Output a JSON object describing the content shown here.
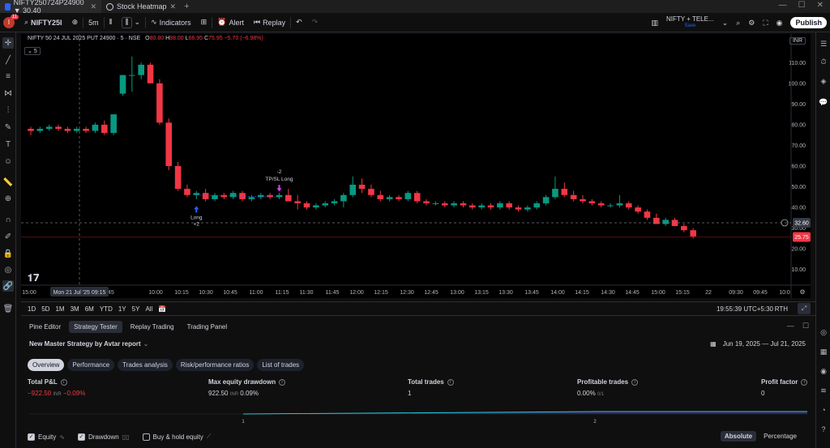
{
  "browser": {
    "tabs": [
      {
        "label": "NIFTY250724P24900 ▼ 30.40",
        "active": true
      },
      {
        "label": "Stock Heatmap",
        "active": false
      }
    ]
  },
  "toolbar": {
    "notif_count": "11",
    "symbol": "NIFTY25I",
    "interval": "5m",
    "indicators": "Indicators",
    "alert": "Alert",
    "replay": "Replay",
    "layout_name": "NIFTY + TELE...",
    "layout_sub": "Save",
    "publish": "Publish"
  },
  "legend": {
    "title": "NIFTY 50 24 JUL 2025 PUT 24900 · 5 · NSE",
    "o": "O",
    "o_val": "80.80",
    "h": "H",
    "h_val": "88.00",
    "l": "L",
    "l_val": "66.95",
    "c": "C",
    "c_val": "75.95",
    "chg": "−5.70 (−6.98%)",
    "sub": "5",
    "currency": "INR"
  },
  "chart_data": {
    "type": "candlestick",
    "y_ticks": [
      "110.00",
      "100.00",
      "90.00",
      "80.00",
      "70.00",
      "60.00",
      "50.00",
      "40.00",
      "30.00",
      "20.00",
      "10.00"
    ],
    "ylim": [
      4,
      116
    ],
    "x_ticks": [
      "15:00",
      "09:45",
      "10:00",
      "10:15",
      "10:30",
      "10:45",
      "11:00",
      "11:15",
      "11:30",
      "11:45",
      "12:00",
      "12:15",
      "12:30",
      "12:45",
      "13:00",
      "13:15",
      "13:30",
      "13:45",
      "14:00",
      "14:15",
      "14:30",
      "14:45",
      "15:00",
      "15:15",
      "22",
      "09:30",
      "09:45",
      "10:0"
    ],
    "crosshair_label": "Mon 21 Jul '25   09:15",
    "price_label_cross": "32.60",
    "price_label_last": "25.75",
    "candles": [
      [
        78,
        79,
        75,
        77
      ],
      [
        77,
        79,
        76,
        78
      ],
      [
        78,
        80,
        77,
        79
      ],
      [
        79,
        80,
        77,
        78
      ],
      [
        78,
        79,
        76,
        77
      ],
      [
        77,
        79,
        76,
        78
      ],
      [
        78,
        79,
        76,
        77
      ],
      [
        77,
        81,
        76,
        80
      ],
      [
        80,
        82,
        75,
        76
      ],
      [
        76,
        85,
        75,
        85
      ],
      [
        95,
        104,
        94,
        104
      ],
      [
        104,
        113,
        96,
        104
      ],
      [
        104,
        110,
        102,
        109
      ],
      [
        109,
        110,
        100,
        100
      ],
      [
        100,
        102,
        80,
        81
      ],
      [
        81,
        83,
        58,
        60
      ],
      [
        60,
        62,
        48,
        49
      ],
      [
        49,
        51,
        45,
        46
      ],
      [
        46,
        48,
        44,
        47
      ],
      [
        47,
        49,
        43,
        44
      ],
      [
        44,
        47,
        43,
        46
      ],
      [
        46,
        47,
        44,
        45
      ],
      [
        45,
        48,
        44,
        47
      ],
      [
        47,
        48,
        43,
        44
      ],
      [
        44,
        46,
        43,
        45
      ],
      [
        45,
        47,
        44,
        46
      ],
      [
        46,
        47,
        44,
        45
      ],
      [
        45,
        47,
        44,
        46
      ],
      [
        46,
        49,
        43,
        43
      ],
      [
        43,
        46,
        39,
        42
      ],
      [
        42,
        43,
        39,
        40
      ],
      [
        40,
        42,
        39,
        41
      ],
      [
        41,
        43,
        40,
        42
      ],
      [
        42,
        44,
        41,
        43
      ],
      [
        43,
        47,
        40,
        46
      ],
      [
        46,
        55,
        45,
        51
      ],
      [
        51,
        54,
        47,
        49
      ],
      [
        49,
        51,
        45,
        46
      ],
      [
        46,
        48,
        43,
        44
      ],
      [
        44,
        46,
        43,
        45
      ],
      [
        45,
        46,
        43,
        44
      ],
      [
        44,
        48,
        43,
        47
      ],
      [
        47,
        48,
        42,
        43
      ],
      [
        43,
        44,
        41,
        42
      ],
      [
        42,
        43,
        41,
        42
      ],
      [
        42,
        43,
        40,
        41
      ],
      [
        41,
        43,
        40,
        42
      ],
      [
        42,
        43,
        40,
        41
      ],
      [
        41,
        42,
        39,
        40
      ],
      [
        40,
        42,
        39,
        41
      ],
      [
        41,
        42,
        39,
        40
      ],
      [
        40,
        43,
        39,
        42
      ],
      [
        42,
        43,
        39,
        40
      ],
      [
        40,
        41,
        38,
        39
      ],
      [
        39,
        41,
        38,
        40
      ],
      [
        40,
        43,
        39,
        42
      ],
      [
        42,
        46,
        41,
        45
      ],
      [
        45,
        55,
        44,
        49
      ],
      [
        49,
        52,
        45,
        46
      ],
      [
        46,
        48,
        43,
        44
      ],
      [
        44,
        46,
        42,
        43
      ],
      [
        43,
        44,
        41,
        42
      ],
      [
        42,
        43,
        40,
        41
      ],
      [
        41,
        42,
        40,
        41
      ],
      [
        41,
        46,
        40,
        42
      ],
      [
        42,
        43,
        39,
        40
      ],
      [
        40,
        41,
        37,
        38
      ],
      [
        38,
        39,
        34,
        35
      ],
      [
        35,
        37,
        33,
        32
      ],
      [
        32,
        35,
        31,
        34
      ],
      [
        34,
        35,
        31,
        31
      ],
      [
        31,
        32,
        28,
        29
      ],
      [
        29,
        30,
        25,
        26
      ]
    ],
    "markers": [
      {
        "label": "Long",
        "sub": "+2"
      },
      {
        "label": "TP/SL Long",
        "sub": "-2"
      }
    ]
  },
  "rangebar": {
    "ranges": [
      "1D",
      "5D",
      "1M",
      "3M",
      "6M",
      "YTD",
      "1Y",
      "5Y",
      "All"
    ],
    "time": "19:55:39 UTC+5:30",
    "rth": "RTH"
  },
  "panel": {
    "tabs": [
      "Pine Editor",
      "Strategy Tester",
      "Replay Trading",
      "Trading Panel"
    ],
    "strategy_name": "New Master Strategy by Avtar report",
    "date_range": "Jun 19, 2025 — Jul 21, 2025",
    "pills": [
      "Overview",
      "Performance",
      "Trades analysis",
      "Risk/performance ratios",
      "List of trades"
    ],
    "metrics": [
      {
        "label": "Total P&L",
        "value": "−922.50",
        "unit": "INR",
        "pct": "−0.09%",
        "neg": true
      },
      {
        "label": "Max equity drawdown",
        "value": "922.50",
        "unit": "INR",
        "pct": "0.09%",
        "neg": false
      },
      {
        "label": "Total trades",
        "value": "1",
        "unit": "",
        "pct": "",
        "neg": false
      },
      {
        "label": "Profitable trades",
        "value": "0.00%",
        "unit": "0/1",
        "pct": "",
        "neg": false
      },
      {
        "label": "Profit factor",
        "value": "0",
        "unit": "",
        "pct": "",
        "neg": false
      }
    ],
    "equity_ticks": [
      "1",
      "2"
    ],
    "checks": [
      {
        "label": "Equity",
        "on": true
      },
      {
        "label": "Drawdown",
        "on": true
      },
      {
        "label": "Buy & hold equity",
        "on": false
      }
    ],
    "mode": [
      "Absolute",
      "Percentage"
    ]
  },
  "colors": {
    "up": "#089981",
    "down": "#f23645",
    "bg": "#000000"
  }
}
